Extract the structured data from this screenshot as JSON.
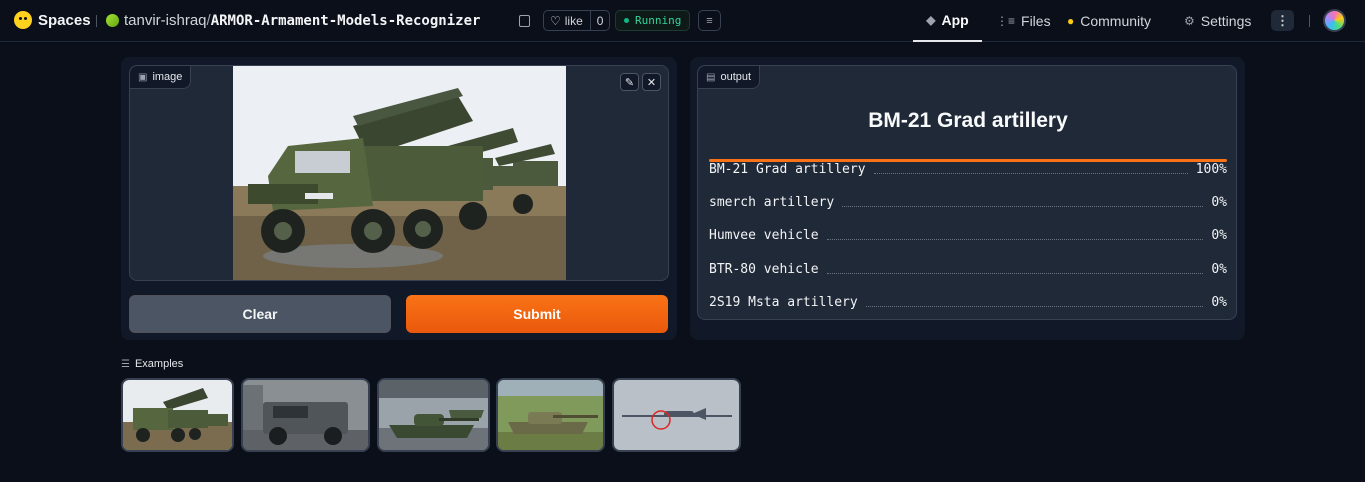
{
  "header": {
    "brand": "Spaces",
    "owner": "tanvir-ishraq",
    "slash": "/",
    "repo_name": "ARMOR-Armament-Models-Recognizer",
    "like_label": "like",
    "like_count": "0",
    "status": "Running",
    "nav": [
      {
        "label": "App",
        "icon": "cube-icon",
        "active": true
      },
      {
        "label": "Files",
        "icon": "files-icon"
      },
      {
        "label": "Community",
        "icon": "community-icon"
      },
      {
        "label": "Settings",
        "icon": "gear-icon"
      }
    ]
  },
  "input": {
    "tag": "image",
    "clear_label": "Clear",
    "submit_label": "Submit"
  },
  "output": {
    "tag": "output",
    "top_label": "BM-21 Grad artillery",
    "confidences": [
      {
        "label": "BM-21 Grad artillery",
        "value": "100%"
      },
      {
        "label": "smerch artillery",
        "value": "0%"
      },
      {
        "label": "Humvee vehicle",
        "value": "0%"
      },
      {
        "label": "BTR-80 vehicle",
        "value": "0%"
      },
      {
        "label": "2S19 Msta artillery",
        "value": "0%"
      }
    ]
  },
  "examples": {
    "label": "Examples",
    "items": [
      "rocket-launcher-trucks",
      "armored-humvee",
      "tank-parade",
      "tank-field",
      "drone-sky"
    ]
  },
  "colors": {
    "accent": "#f97316",
    "background": "#0b0f19",
    "panel": "#111827"
  }
}
